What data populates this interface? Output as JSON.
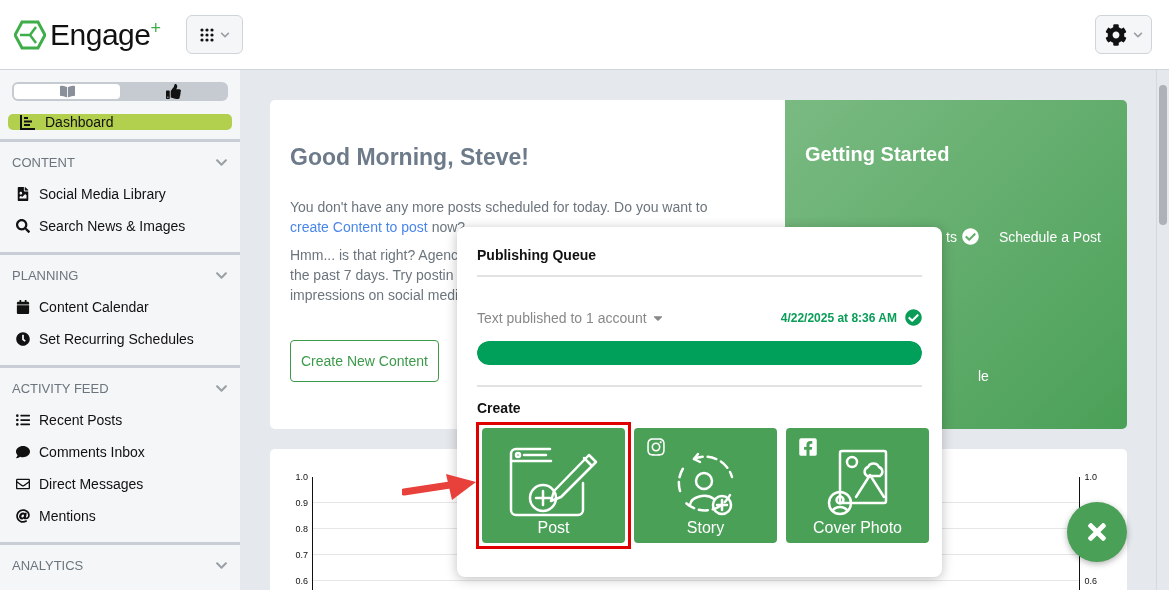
{
  "header": {
    "logo": "Engage$^{+}$",
    "apps_button": {
      "kind": "apps"
    },
    "settings_button": {
      "kind": "settings"
    }
  },
  "sidebar": {
    "view_toggle": [
      {
        "kind": "book",
        "selected": false
      },
      {
        "kind": "thumbs-up",
        "selected": true
      }
    ],
    "dashboard": {
      "label": "Dashboard",
      "kind": "dashboard",
      "selected": true
    },
    "sections": [
      {
        "title": "CONTENT",
        "expanded": true,
        "items": [
          {
            "label": "Social Media Library",
            "kind": "file-image"
          },
          {
            "label": "Search News & Images",
            "kind": "search"
          }
        ]
      },
      {
        "title": "PLANNING",
        "expanded": true,
        "items": [
          {
            "label": "Content Calendar",
            "kind": "calendar"
          },
          {
            "label": "Set Recurring Schedules",
            "kind": "clock"
          }
        ]
      },
      {
        "title": "ACTIVITY FEED",
        "expanded": true,
        "items": [
          {
            "label": "Recent Posts",
            "kind": "list"
          },
          {
            "label": "Comments Inbox",
            "kind": "comment"
          },
          {
            "label": "Direct Messages",
            "kind": "envelope"
          },
          {
            "label": "Mentions",
            "kind": "at"
          }
        ]
      },
      {
        "title": "ANALYTICS",
        "expanded": true
      }
    ]
  },
  "welcome": {
    "title": "Good Morning, Steve!",
    "message": {
      "before": "You don't have any more posts scheduled for today. Do you want to ",
      "link": "create Content to post",
      "after": " now?"
    },
    "hint_lines": [
      "Hmm... is that right? Agenc",
      "the past 7 days. Try postin",
      "impressions on social medi"
    ],
    "button": "Create New Content"
  },
  "getting_started": {
    "title": "Getting Started",
    "step_fragment": "ts",
    "step_done": true,
    "step_next": "Schedule a Post",
    "lower_fragment": "le"
  },
  "chart": {
    "left_ticks": [
      "1.0",
      "0.9",
      "0.8",
      "0.7",
      "0.6"
    ],
    "right_ticks": [
      "1.0",
      "0.6"
    ]
  },
  "popup": {
    "title": "Publishing Queue",
    "queue_item": {
      "text": "Text published to 1 account",
      "time": "4/22/2025 at 8:36 AM",
      "done": true,
      "level": 1
    },
    "create_title": "Create",
    "tiles": [
      {
        "label": "Post",
        "kind": "post",
        "highlighted": true
      },
      {
        "label": "Story",
        "kind": "story",
        "badge": {
          "kind": "instagram"
        },
        "highlighted": false
      },
      {
        "label": "Cover Photo",
        "kind": "cover",
        "badge": {
          "kind": "facebook"
        },
        "highlighted": false
      }
    ]
  },
  "close_button": {
    "kind": "close"
  }
}
